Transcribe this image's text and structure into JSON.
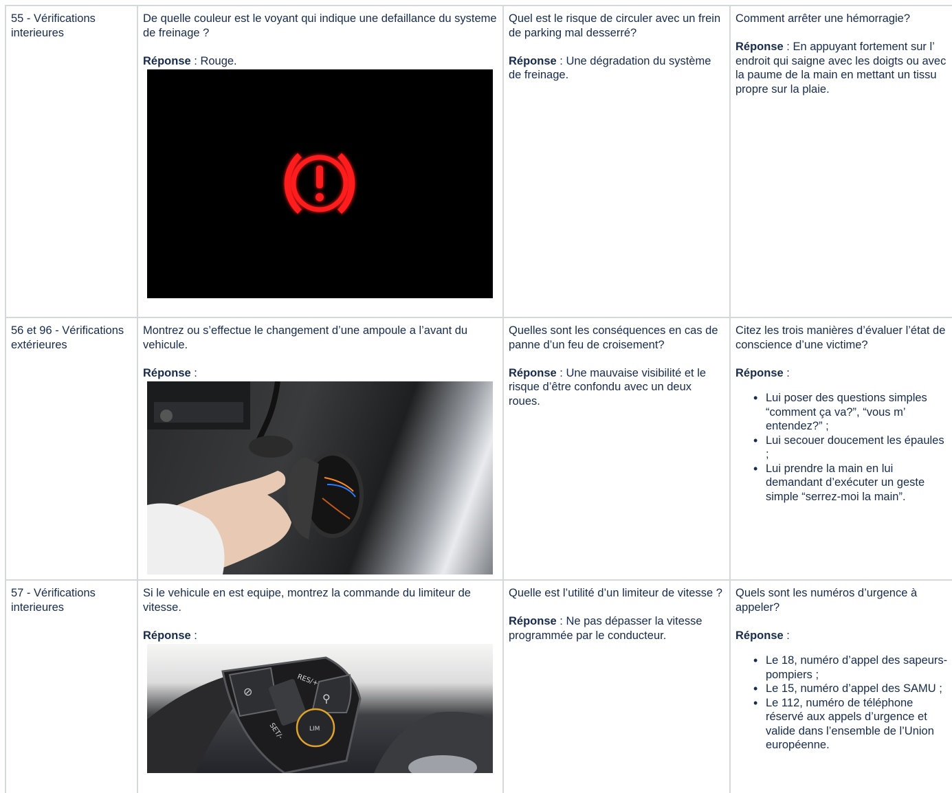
{
  "rows": [
    {
      "section": "55 - Vérifications interieures",
      "q1": "De quelle couleur est le voyant qui indique une defaillance du systeme de freinage ?",
      "a1_label": "Réponse",
      "a1_text": " : Rouge.",
      "q2": "Quel est le risque de circuler avec un frein de parking mal desserré?",
      "a2_label": "Réponse",
      "a2_text": " : Une dégradation du système de freinage.",
      "q3": "Comment arrêter une hémorragie?",
      "a3_label": "Réponse",
      "a3_text": " : En appuyant fortement sur l’ endroit qui saigne avec les doigts ou avec la paume de la main en mettant un tissu propre sur la plaie."
    },
    {
      "section": "56 et 96 - Vérifications extérieures",
      "q1": "Montrez ou s’effectue le changement d’une ampoule a l’avant du vehicule.",
      "a1_label": "Réponse",
      "a1_text": " :",
      "q2": "Quelles sont les conséquences en cas de panne d’un feu de croisement?",
      "a2_label": "Réponse",
      "a2_text": " : Une mauvaise visibilité et le risque d’être confondu avec un deux roues.",
      "q3": "Citez les trois manières d’évaluer l’état de conscience d’une victime?",
      "a3_label": "Réponse",
      "a3_text": " :",
      "list": [
        "Lui poser des questions simples “comment ça va?”, “vous m’ entendez?” ;",
        "Lui secouer doucement les épaules ;",
        "Lui prendre la main en lui demandant d’exécuter un geste simple “serrez-moi la main”."
      ]
    },
    {
      "section": "57 - Vérifications interieures",
      "q1": "Si le vehicule en est equipe, montrez la commande du limiteur de vitesse.",
      "a1_label": "Réponse",
      "a1_text": " :",
      "q2": "Quelle est l’utilité d’un limiteur de vitesse ?",
      "a2_label": "Réponse",
      "a2_text": " : Ne pas dépasser la vitesse programmée par le conducteur.",
      "q3": "Quels sont les numéros d’urgence à appeler?",
      "a3_label": "Réponse",
      "a3_text": " :",
      "list": [
        "Le 18, numéro d’appel des sapeurs-pompiers ;",
        "Le 15, numéro d’appel des SAMU ;",
        "Le 112, numéro de téléphone réservé aux appels d’urgence et valide dans l’ensemble de l’Union européenne."
      ]
    }
  ],
  "images": {
    "brake_warning": {
      "color": "#ff1a1a"
    },
    "steering_labels": {
      "res": "RES/+",
      "set": "SET/-",
      "lim": "LIM"
    }
  }
}
